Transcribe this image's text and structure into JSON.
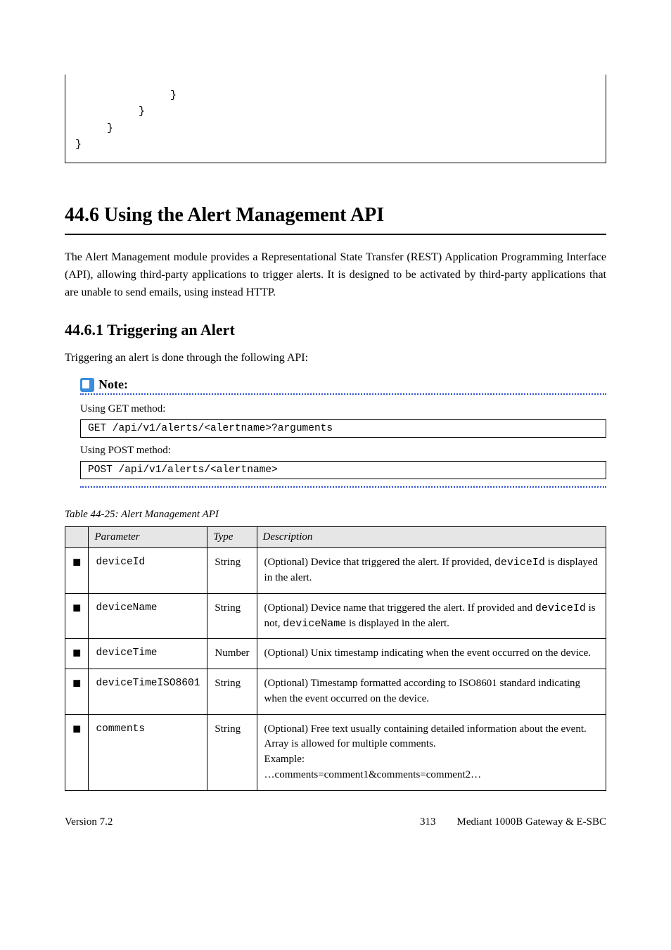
{
  "codebox": {
    "l1": "               }",
    "l2": "          }",
    "l3": "     }",
    "l4": "}"
  },
  "heading": "44.6 Using the Alert Management API",
  "para": "The Alert Management module provides a Representational State Transfer (REST) Application Programming Interface (API), allowing third-party applications to trigger alerts. It is designed to be activated by third-party applications that are unable to send emails, using instead HTTP.",
  "subhead": "44.6.1 Triggering an Alert",
  "subtext": "Triggering an alert is done through the following API:",
  "note": {
    "label": "Note:",
    "get_desc": "Using GET method:",
    "get_code": "GET /api/v1/alerts/<alertname>?arguments",
    "post_desc": "Using POST method:",
    "post_code": "POST /api/v1/alerts/<alertname>"
  },
  "table": {
    "caption": "Table 44-25: Alert Management API",
    "headers": {
      "parameter": "Parameter",
      "type": "Type",
      "description": "Description"
    },
    "rows": [
      {
        "symbol": "◼",
        "param": "deviceId",
        "type": "String",
        "desc_pre": "(Optional) Device that triggered the alert. If provided,",
        "desc_mono": "deviceId",
        "desc_post": " is displayed in the alert."
      },
      {
        "symbol": "◼",
        "param": "deviceName",
        "type": "String",
        "desc_pre": "(Optional) Device name that triggered the alert. If provided and ",
        "desc_mono": "deviceId",
        "desc_mid": " is not, ",
        "desc_mono2": "deviceName",
        "desc_post": " is displayed in the alert."
      },
      {
        "symbol": "◼",
        "param": "deviceTime",
        "type": "Number",
        "desc_pre": "(Optional) Unix timestamp indicating when the event occurred on the device."
      },
      {
        "symbol": "◼",
        "param": "deviceTimeISO8601",
        "type": "String",
        "desc_pre": "(Optional) Timestamp formatted according to ISO8601 standard indicating when the event occurred on the device."
      },
      {
        "symbol": "◼",
        "param": "comments",
        "type": "String",
        "desc_lines": [
          "(Optional) Free text usually containing detailed information about the event. Array is allowed for multiple comments.",
          "Example:",
          "…comments=comment1&comments=comment2…"
        ]
      }
    ]
  },
  "footer": {
    "left": "Version 7.2",
    "right_page": "313",
    "right_product": "Mediant 1000B Gateway & E-SBC"
  }
}
